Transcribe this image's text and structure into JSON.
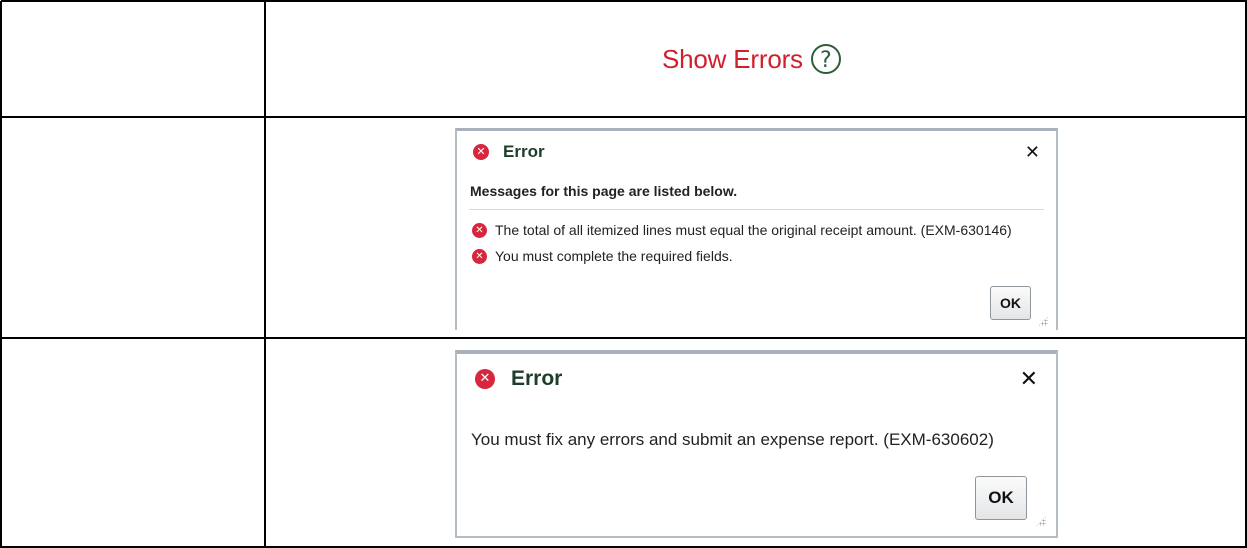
{
  "row1": {
    "show_errors_label": "Show Errors",
    "help_icon_glyph": "?"
  },
  "dialog1": {
    "title": "Error",
    "close_glyph": "✕",
    "subtitle": "Messages for this page are listed below.",
    "messages": [
      "The total of all itemized lines must equal the original receipt amount. (EXM-630146)",
      "You must complete the required fields."
    ],
    "ok_label": "OK"
  },
  "dialog2": {
    "title": "Error",
    "close_glyph": "✕",
    "message": "You must fix any errors and submit an expense report. (EXM-630602)",
    "ok_label": "OK"
  },
  "colors": {
    "show_errors_text": "#d0202f",
    "help_icon": "#2f5d3a",
    "error_icon": "#d7263d",
    "dialog_title": "#1f3d2c"
  },
  "icons": {
    "error": "error-circle-x-icon",
    "close": "close-icon",
    "help": "question-circle-icon",
    "resize": "resize-grip-icon"
  }
}
